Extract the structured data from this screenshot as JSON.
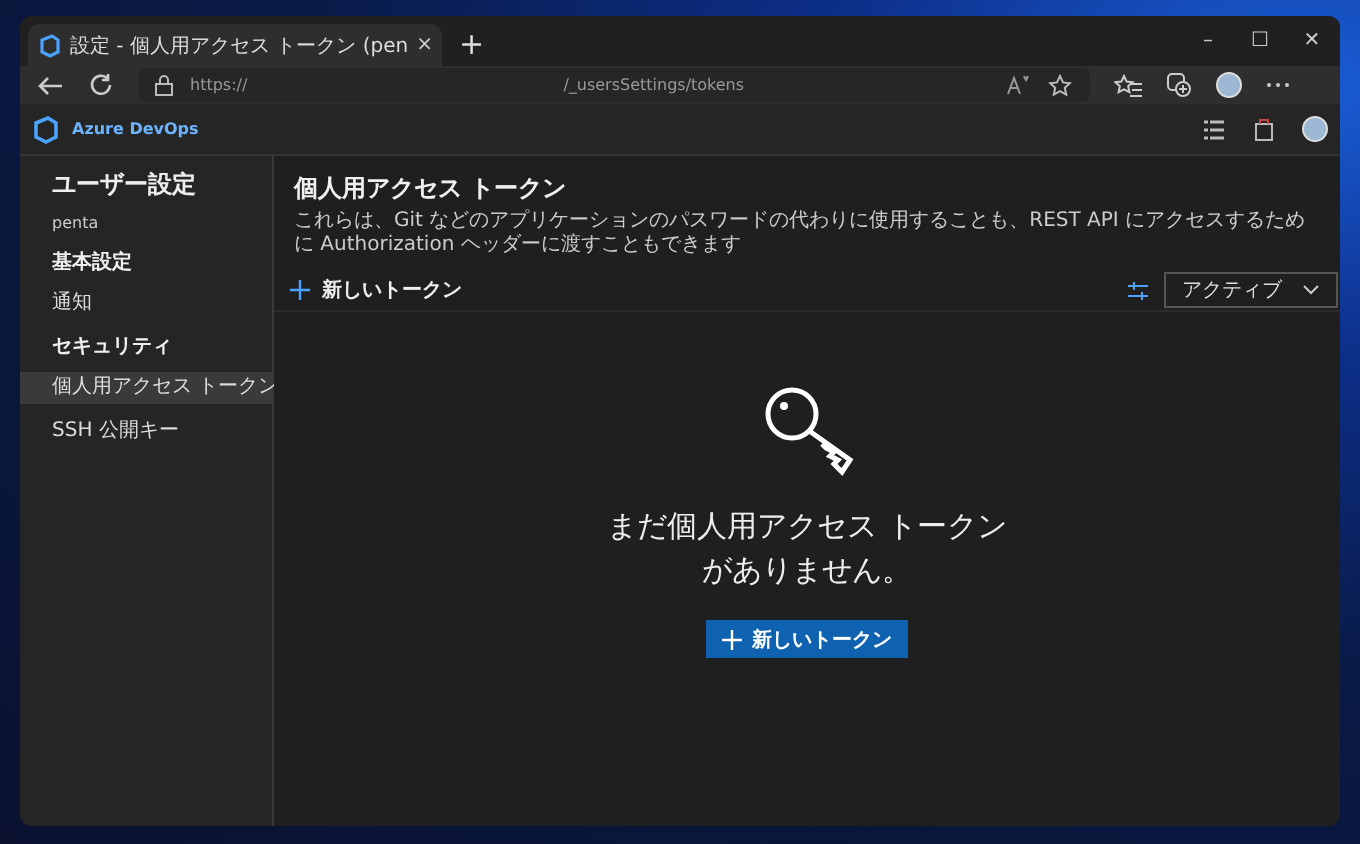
{
  "browser": {
    "tab": {
      "title": "設定 - 個人用アクセス トークン (pen",
      "close": "×",
      "selected": true
    },
    "new_tab": "+",
    "address": {
      "scheme": "https://",
      "path": "/_usersSettings/tokens"
    },
    "window_controls": [
      "–",
      "☐",
      "✕"
    ]
  },
  "app": {
    "brand": "Azure DevOps"
  },
  "sidebar": {
    "title": "ユーザー設定",
    "user": "penta",
    "sections": [
      {
        "heading": "基本設定",
        "items": [
          {
            "label": "通知",
            "selected": false
          }
        ]
      },
      {
        "heading": "セキュリティ",
        "items": [
          {
            "label": "個人用アクセス トークン",
            "selected": true
          },
          {
            "label": "SSH 公開キー",
            "selected": false
          }
        ]
      }
    ]
  },
  "page": {
    "title": "個人用アクセス トークン",
    "description": "これらは、Git などのアプリケーションのパスワードの代わりに使用することも、REST API にアクセスするために Authorization ヘッダーに渡すこともできます",
    "new_token": "新しいトークン",
    "filter": "アクティブ"
  },
  "empty_state": {
    "message": "まだ個人用アクセス トークンがありません。",
    "button": "新しいトークン"
  }
}
